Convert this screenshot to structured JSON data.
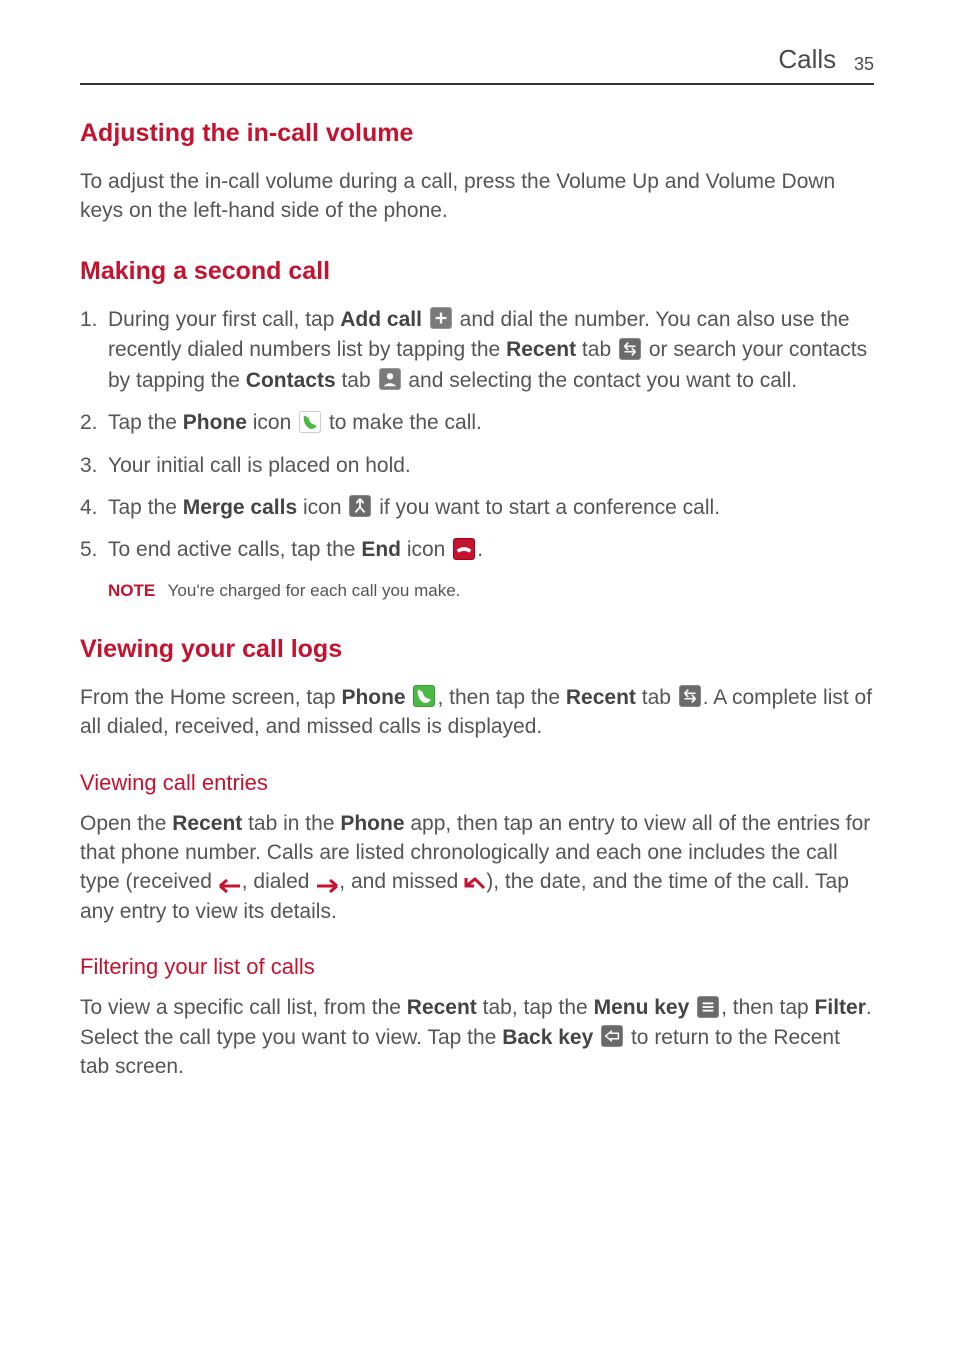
{
  "header": {
    "section": "Calls",
    "page": "35"
  },
  "s1": {
    "title": "Adjusting the in-call volume",
    "body": "To adjust the in-call volume during a call, press the Volume Up and Volume Down keys on the left-hand side of the phone."
  },
  "s2": {
    "title": "Making a second call",
    "step1_a": "During your first call, tap ",
    "step1_addcall": "Add call",
    "step1_b": " and dial the number. You can also use the recently dialed numbers list by tapping the ",
    "step1_recent": "Recent",
    "step1_c": " tab ",
    "step1_d": " or search your contacts by tapping the ",
    "step1_contacts": "Contacts",
    "step1_e": " tab ",
    "step1_f": " and selecting the contact you want to call.",
    "step2_a": "Tap the ",
    "step2_phone": "Phone",
    "step2_b": " icon ",
    "step2_c": " to make the call.",
    "step3": "Your initial call is placed on hold.",
    "step4_a": "Tap the ",
    "step4_merge": "Merge calls",
    "step4_b": " icon ",
    "step4_c": " if you want to start a conference call.",
    "step5_a": "To end active calls, tap the ",
    "step5_end": "End",
    "step5_b": " icon ",
    "step5_c": ".",
    "note_label": "NOTE",
    "note_text": "You're charged for each call you make."
  },
  "s3": {
    "title": "Viewing your call logs",
    "body_a": "From the Home screen, tap ",
    "body_phone": "Phone",
    "body_b": ", then tap the ",
    "body_recent": "Recent",
    "body_c": " tab ",
    "body_d": ". A complete list of all dialed, received, and missed calls is displayed."
  },
  "s4": {
    "title": "Viewing call entries",
    "body_a": "Open the ",
    "body_recent": "Recent",
    "body_b": " tab in the ",
    "body_phone": "Phone",
    "body_c": " app, then tap an entry to view all of the entries for that phone number. Calls are listed chronologically and each one includes the call type (received ",
    "body_d": ", dialed ",
    "body_e": ", and missed ",
    "body_f": "), the date, and the time of the call. Tap any entry to view its details."
  },
  "s5": {
    "title": "Filtering your list of calls",
    "body_a": "To view a specific call list, from the ",
    "body_recent": "Recent",
    "body_b": " tab, tap the ",
    "body_menu": "Menu key",
    "body_c": ", then tap ",
    "body_filter": "Filter",
    "body_d": ". Select the call type you want to view. Tap the ",
    "body_back": "Back key",
    "body_e": " to return to the Recent tab screen."
  }
}
